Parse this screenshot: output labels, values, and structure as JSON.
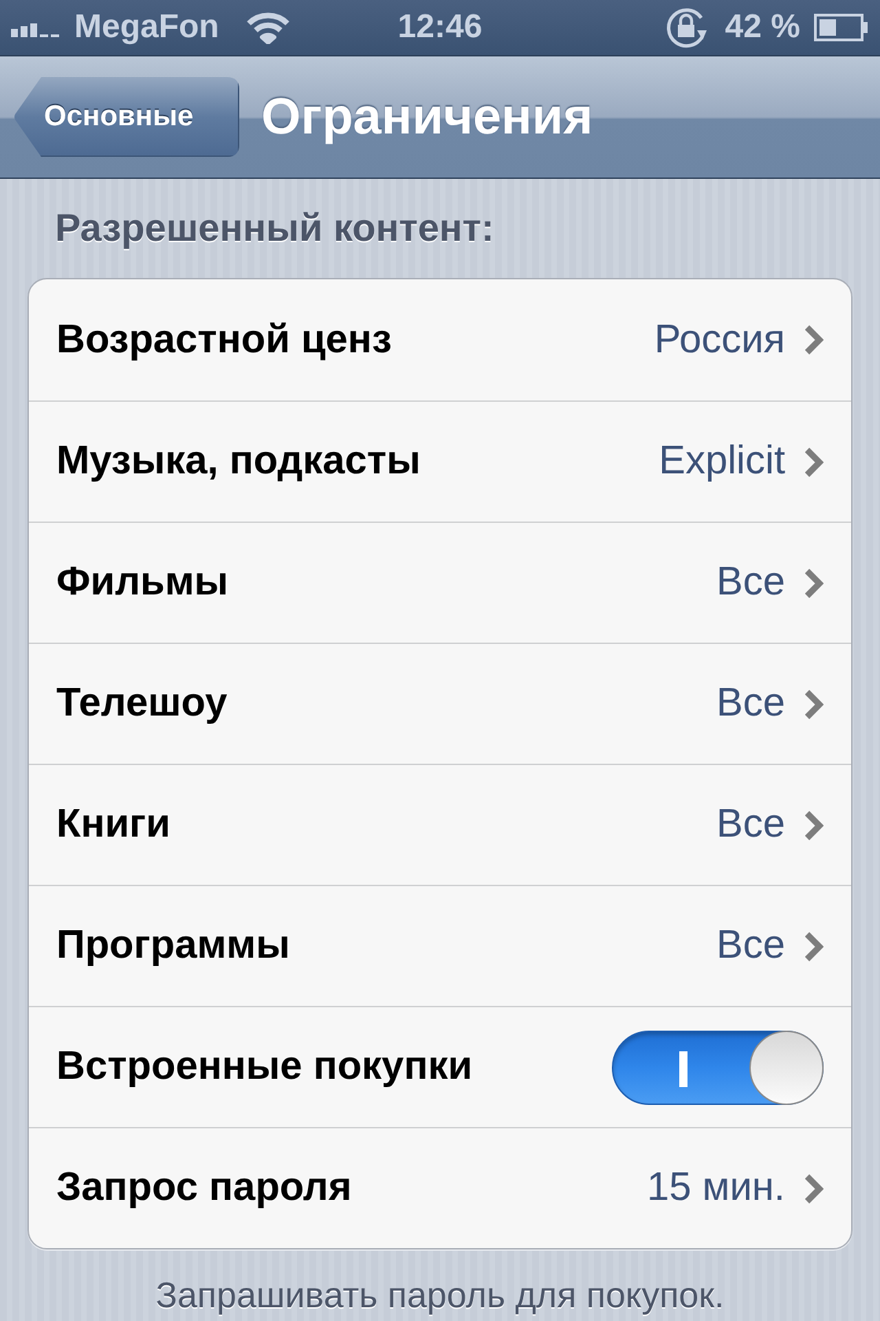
{
  "status_bar": {
    "carrier": "MegaFon",
    "time": "12:46",
    "battery": "42 %"
  },
  "nav_bar": {
    "back_button": "Основные",
    "title": "Ограничения"
  },
  "section": {
    "header": "Разрешенный контент:",
    "rows": [
      {
        "kind": "disclosure",
        "label": "Возрастной ценз",
        "value": "Россия"
      },
      {
        "kind": "disclosure",
        "label": "Музыка, подкасты",
        "value": "Explicit"
      },
      {
        "kind": "disclosure",
        "label": "Фильмы",
        "value": "Все"
      },
      {
        "kind": "disclosure",
        "label": "Телешоу",
        "value": "Все"
      },
      {
        "kind": "disclosure",
        "label": "Книги",
        "value": "Все"
      },
      {
        "kind": "disclosure",
        "label": "Программы",
        "value": "Все"
      },
      {
        "kind": "switch",
        "label": "Встроенные покупки",
        "on": true
      },
      {
        "kind": "disclosure",
        "label": "Запрос пароля",
        "value": "15 мин."
      }
    ],
    "footer": "Запрашивать пароль для покупок."
  }
}
